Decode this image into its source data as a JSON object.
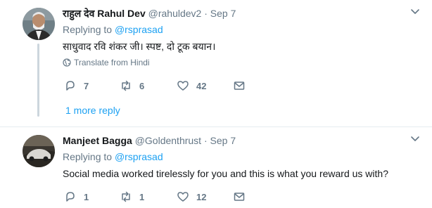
{
  "tweets": [
    {
      "display_name": "राहुल देव Rahul Dev",
      "handle": "@rahuldev2",
      "separator": "·",
      "time": "Sep 7",
      "replying_prefix": "Replying to",
      "replying_to": "@rsprasad",
      "text": "साधुवाद रवि शंकर जी। स्पष्ट, दो टूक बयान।",
      "translate": "Translate from Hindi",
      "replies": "7",
      "retweets": "6",
      "likes": "42",
      "more_replies": "1 more reply"
    },
    {
      "display_name": "Manjeet Bagga",
      "handle": "@Goldenthrust",
      "separator": "·",
      "time": "Sep 7",
      "replying_prefix": "Replying to",
      "replying_to": "@rsprasad",
      "text": "Social media worked tirelessly for you and this is what you reward us with?",
      "replies": "1",
      "retweets": "1",
      "likes": "12"
    }
  ],
  "colors": {
    "link": "#1da1f2",
    "secondary": "#657786",
    "divider": "#e6ecf0"
  }
}
